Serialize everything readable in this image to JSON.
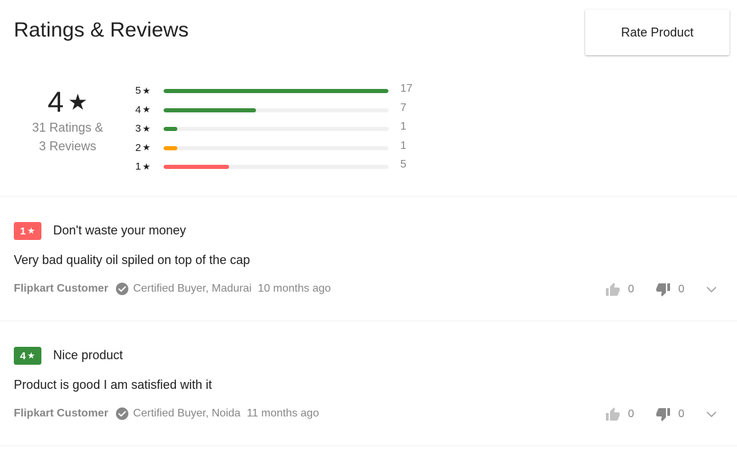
{
  "header": {
    "title": "Ratings & Reviews",
    "rate_button": "Rate Product"
  },
  "summary": {
    "average": "4",
    "star_glyph": "★",
    "ratings_line": "31 Ratings &",
    "reviews_line": "3 Reviews",
    "distribution": [
      {
        "stars": "5",
        "count": "17",
        "fraction": 1.0,
        "color": "#388e3c"
      },
      {
        "stars": "4",
        "count": "7",
        "fraction": 0.41,
        "color": "#388e3c"
      },
      {
        "stars": "3",
        "count": "1",
        "fraction": 0.06,
        "color": "#388e3c"
      },
      {
        "stars": "2",
        "count": "1",
        "fraction": 0.06,
        "color": "#ff9f00"
      },
      {
        "stars": "1",
        "count": "5",
        "fraction": 0.29,
        "color": "#ff6161"
      }
    ]
  },
  "reviews": [
    {
      "rating": "1",
      "badge_color": "#ff6161",
      "title": "Don't waste your money",
      "text": "Very bad quality oil spiled on top of the cap",
      "author": "Flipkart Customer",
      "certified": "Certified Buyer, Madurai",
      "time": "10 months ago",
      "likes": "0",
      "dislikes": "0"
    },
    {
      "rating": "4",
      "badge_color": "#388e3c",
      "title": "Nice product",
      "text": "Product is good I am satisfied with it",
      "author": "Flipkart Customer",
      "certified": "Certified Buyer, Noida",
      "time": "11 months ago",
      "likes": "0",
      "dislikes": "0"
    }
  ],
  "icons": {
    "certified": "check-circle-icon",
    "like": "thumbs-up-icon",
    "dislike": "thumbs-down-icon",
    "expand": "chevron-down-icon"
  }
}
